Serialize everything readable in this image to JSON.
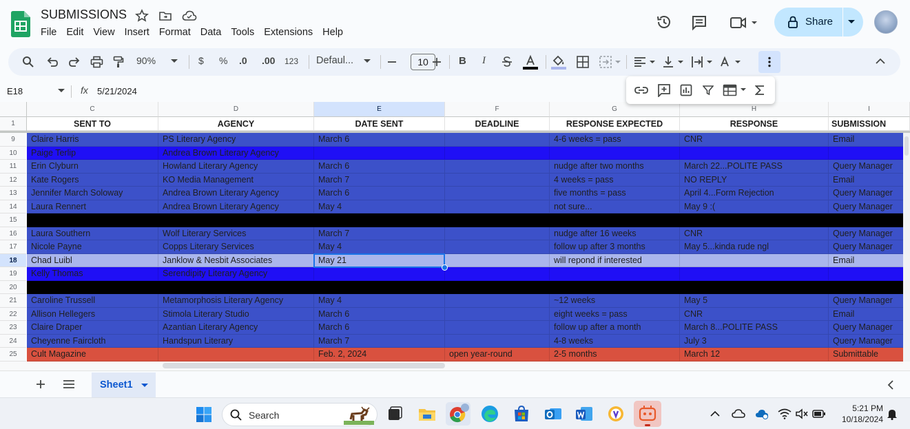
{
  "app": {
    "title": "SUBMISSIONS",
    "menu": [
      "File",
      "Edit",
      "View",
      "Insert",
      "Format",
      "Data",
      "Tools",
      "Extensions",
      "Help"
    ],
    "share_label": "Share"
  },
  "toolbar": {
    "zoom": "90%",
    "currency": "$",
    "percent": "%",
    "dec_decrease": ".0",
    "dec_increase": ".00",
    "number_format": "123",
    "font": "Defaul...",
    "font_size": "10",
    "bold": "B",
    "italic": "I"
  },
  "formula_bar": {
    "cell_ref": "E18",
    "fx": "fx",
    "value": "5/21/2024"
  },
  "columns": [
    "C",
    "D",
    "E",
    "F",
    "G",
    "H",
    "I"
  ],
  "headers": [
    "SENT TO",
    "AGENCY",
    "DATE SENT",
    "DEADLINE",
    "RESPONSE EXPECTED",
    "RESPONSE",
    "SUBMISSION"
  ],
  "row_numbers": [
    "1",
    "9",
    "10",
    "11",
    "12",
    "13",
    "14",
    "15",
    "16",
    "17",
    "18",
    "19",
    "20",
    "21",
    "22",
    "23",
    "24",
    "25"
  ],
  "rows": [
    {
      "num": "9",
      "color": "#3c51c9",
      "cells": [
        "Claire Harris",
        "PS Literary Agency",
        "March 6",
        "",
        "4-6 weeks = pass",
        "CNR",
        "Email"
      ]
    },
    {
      "num": "10",
      "color": "#1f0ff5",
      "cells": [
        "Paige Terlip",
        "Andrea Brown Literary Agency",
        "",
        "",
        "",
        "",
        ""
      ]
    },
    {
      "num": "11",
      "color": "#3c51c9",
      "cells": [
        "Erin Clyburn",
        "Howland Literary Agency",
        "March 6",
        "",
        "nudge after two months",
        "March 22...POLITE PASS",
        "Query Manager"
      ]
    },
    {
      "num": "12",
      "color": "#3c51c9",
      "cells": [
        "Kate Rogers",
        "KO Media Management",
        "March 7",
        "",
        "4 weeks = pass",
        "NO REPLY",
        "Email"
      ]
    },
    {
      "num": "13",
      "color": "#3c51c9",
      "cells": [
        "Jennifer March Soloway",
        "Andrea Brown Literary Agency",
        "March 6",
        "",
        "five months = pass",
        "April 4...Form Rejection",
        "Query Manager"
      ]
    },
    {
      "num": "14",
      "color": "#3c51c9",
      "cells": [
        "Laura Rennert",
        "Andrea Brown Literary Agency",
        "May 4",
        "",
        "not sure...",
        "May 9 :(",
        "Query Manager"
      ]
    },
    {
      "num": "15",
      "color": "#000000",
      "cells": [
        "",
        "",
        "",
        "",
        "",
        "",
        ""
      ]
    },
    {
      "num": "16",
      "color": "#3c51c9",
      "cells": [
        "Laura Southern",
        "Wolf Literary Services",
        "March 7",
        "",
        "nudge after 16 weeks",
        "CNR",
        "Query Manager"
      ]
    },
    {
      "num": "17",
      "color": "#3c51c9",
      "cells": [
        "Nicole Payne",
        "Copps Literary Services",
        "May 4",
        "",
        "follow up after 3 months",
        "May 5...kinda rude ngl",
        "Query Manager"
      ]
    },
    {
      "num": "18",
      "color": "#aab6ec",
      "cells": [
        "Chad Luibl",
        "Janklow & Nesbit Associates",
        "May 21",
        "",
        "will repond if interested",
        "",
        "Email"
      ]
    },
    {
      "num": "19",
      "color": "#1f0ff5",
      "cells": [
        "Kelly Thomas",
        "Serendipity Literary Agency",
        "",
        "",
        "",
        "",
        ""
      ]
    },
    {
      "num": "20",
      "color": "#000000",
      "cells": [
        "",
        "",
        "",
        "",
        "",
        "",
        ""
      ]
    },
    {
      "num": "21",
      "color": "#3c51c9",
      "cells": [
        "Caroline Trussell",
        "Metamorphosis Literary Agency",
        "May 4",
        "",
        "~12 weeks",
        "May 5",
        "Query Manager"
      ]
    },
    {
      "num": "22",
      "color": "#3c51c9",
      "cells": [
        "Allison Hellegers",
        "Stimola Literary Studio",
        "March 6",
        "",
        "eight weeks = pass",
        "CNR",
        "Email"
      ]
    },
    {
      "num": "23",
      "color": "#3c51c9",
      "cells": [
        "Claire Draper",
        "Azantian Literary Agency",
        "March 6",
        "",
        "follow up after a month",
        "March 8...POLITE PASS",
        "Query Manager"
      ]
    },
    {
      "num": "24",
      "color": "#3c51c9",
      "cells": [
        "Cheyenne Faircloth",
        "Handspun Literary",
        "March 7",
        "",
        "4-8 weeks",
        "July 3",
        "Query Manager"
      ]
    },
    {
      "num": "25",
      "color": "#d9513f",
      "cells": [
        "Cult Magazine",
        "",
        "Feb. 2, 2024",
        "open year-round",
        "2-5 months",
        "March 12",
        "Submittable"
      ]
    }
  ],
  "sheet_tab": "Sheet1",
  "taskbar": {
    "search_placeholder": "Search",
    "time": "5:21 PM",
    "date": "10/18/2024"
  }
}
